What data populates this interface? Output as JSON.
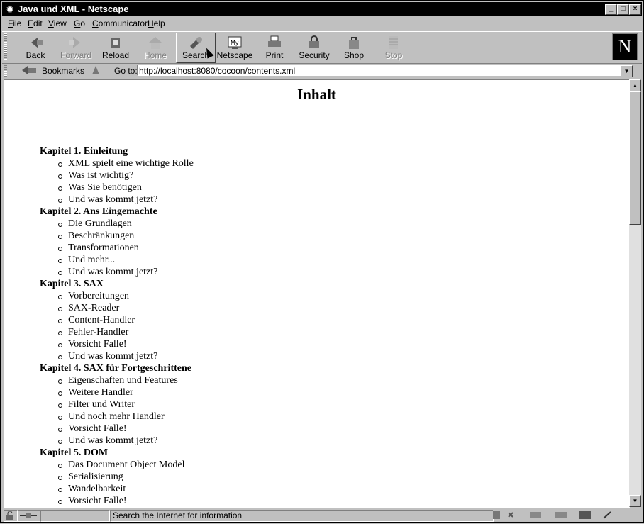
{
  "window": {
    "title": "Java und XML - Netscape",
    "buttons": {
      "minimize": "_",
      "maximize": "□",
      "close": "×"
    }
  },
  "menu": [
    {
      "key": "F",
      "rest": "ile"
    },
    {
      "key": "E",
      "rest": "dit"
    },
    {
      "key": "V",
      "rest": "iew"
    },
    {
      "key": "G",
      "rest": "o"
    },
    {
      "key": "C",
      "rest": "ommunicator"
    },
    {
      "key": "H",
      "rest": "elp"
    }
  ],
  "toolbar": {
    "back": "Back",
    "forward": "Forward",
    "reload": "Reload",
    "home": "Home",
    "search": "Search",
    "netscape": "Netscape",
    "print": "Print",
    "security": "Security",
    "shop": "Shop",
    "stop": "Stop",
    "logo": "N"
  },
  "location": {
    "bookmarks": "Bookmarks",
    "goto_label": "Go to:",
    "url": "http://localhost:8080/cocoon/contents.xml"
  },
  "page": {
    "heading": "Inhalt",
    "chapters": [
      {
        "title": "Kapitel 1. Einleitung",
        "items": [
          "XML spielt eine wichtige Rolle",
          "Was ist wichtig?",
          "Was Sie benötigen",
          "Und was kommt jetzt?"
        ]
      },
      {
        "title": "Kapitel 2. Ans Eingemachte",
        "items": [
          "Die Grundlagen",
          "Beschränkungen",
          "Transformationen",
          "Und mehr...",
          "Und was kommt jetzt?"
        ]
      },
      {
        "title": "Kapitel 3. SAX",
        "items": [
          "Vorbereitungen",
          "SAX-Reader",
          "Content-Handler",
          "Fehler-Handler",
          "Vorsicht Falle!",
          "Und was kommt jetzt?"
        ]
      },
      {
        "title": "Kapitel 4. SAX für Fortgeschrittene",
        "items": [
          "Eigenschaften und Features",
          "Weitere Handler",
          "Filter und Writer",
          "Und noch mehr Handler",
          "Vorsicht Falle!",
          "Und was kommt jetzt?"
        ]
      },
      {
        "title": "Kapitel 5. DOM",
        "items": [
          "Das Document Object Model",
          "Serialisierung",
          "Wandelbarkeit",
          "Vorsicht Falle!"
        ]
      }
    ]
  },
  "status": {
    "text": "Search the Internet for information"
  }
}
